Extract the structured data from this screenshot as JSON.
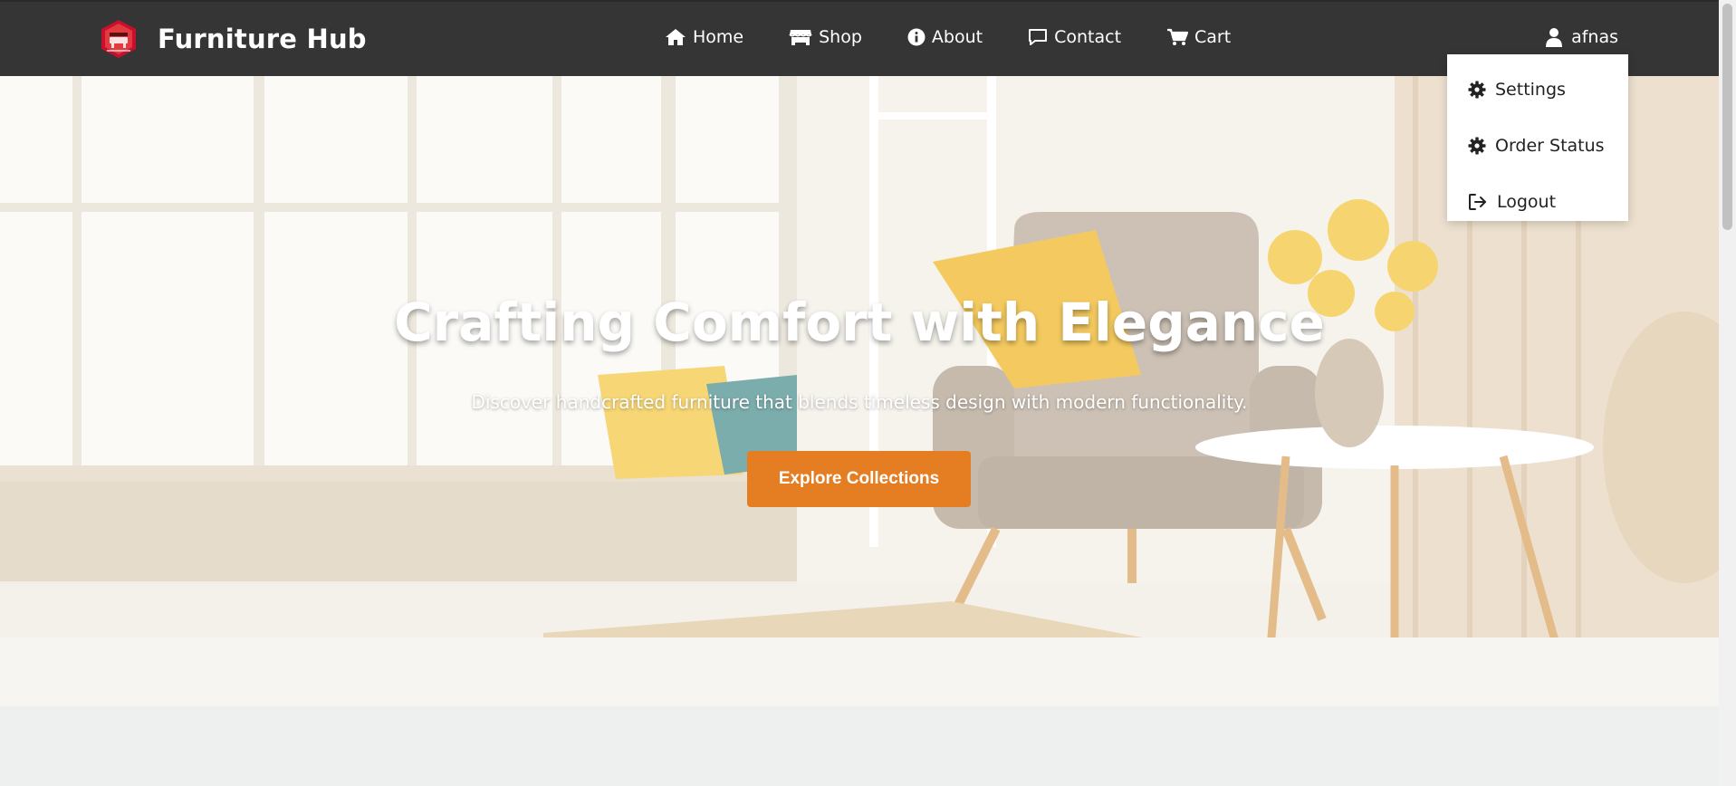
{
  "brand": {
    "name": "Furniture Hub",
    "logo_icon": "furniture-logo-icon"
  },
  "nav": {
    "items": [
      {
        "label": "Home",
        "icon": "home-icon"
      },
      {
        "label": "Shop",
        "icon": "store-icon"
      },
      {
        "label": "About",
        "icon": "info-icon"
      },
      {
        "label": "Contact",
        "icon": "message-icon"
      },
      {
        "label": "Cart",
        "icon": "cart-icon"
      }
    ]
  },
  "user": {
    "name": "afnas",
    "icon": "user-icon"
  },
  "dropdown": {
    "items": [
      {
        "label": "Settings",
        "icon": "gear-icon"
      },
      {
        "label": "Order Status",
        "icon": "gear-icon"
      },
      {
        "label": "Logout",
        "icon": "logout-icon"
      }
    ]
  },
  "hero": {
    "title": "Crafting Comfort with Elegance",
    "subtitle": "Discover handcrafted furniture that blends timeless design with modern functionality.",
    "button_label": "Explore Collections"
  },
  "colors": {
    "navbar": "#353535",
    "accent": "#e57e22",
    "page_background": "#eef0f0"
  }
}
